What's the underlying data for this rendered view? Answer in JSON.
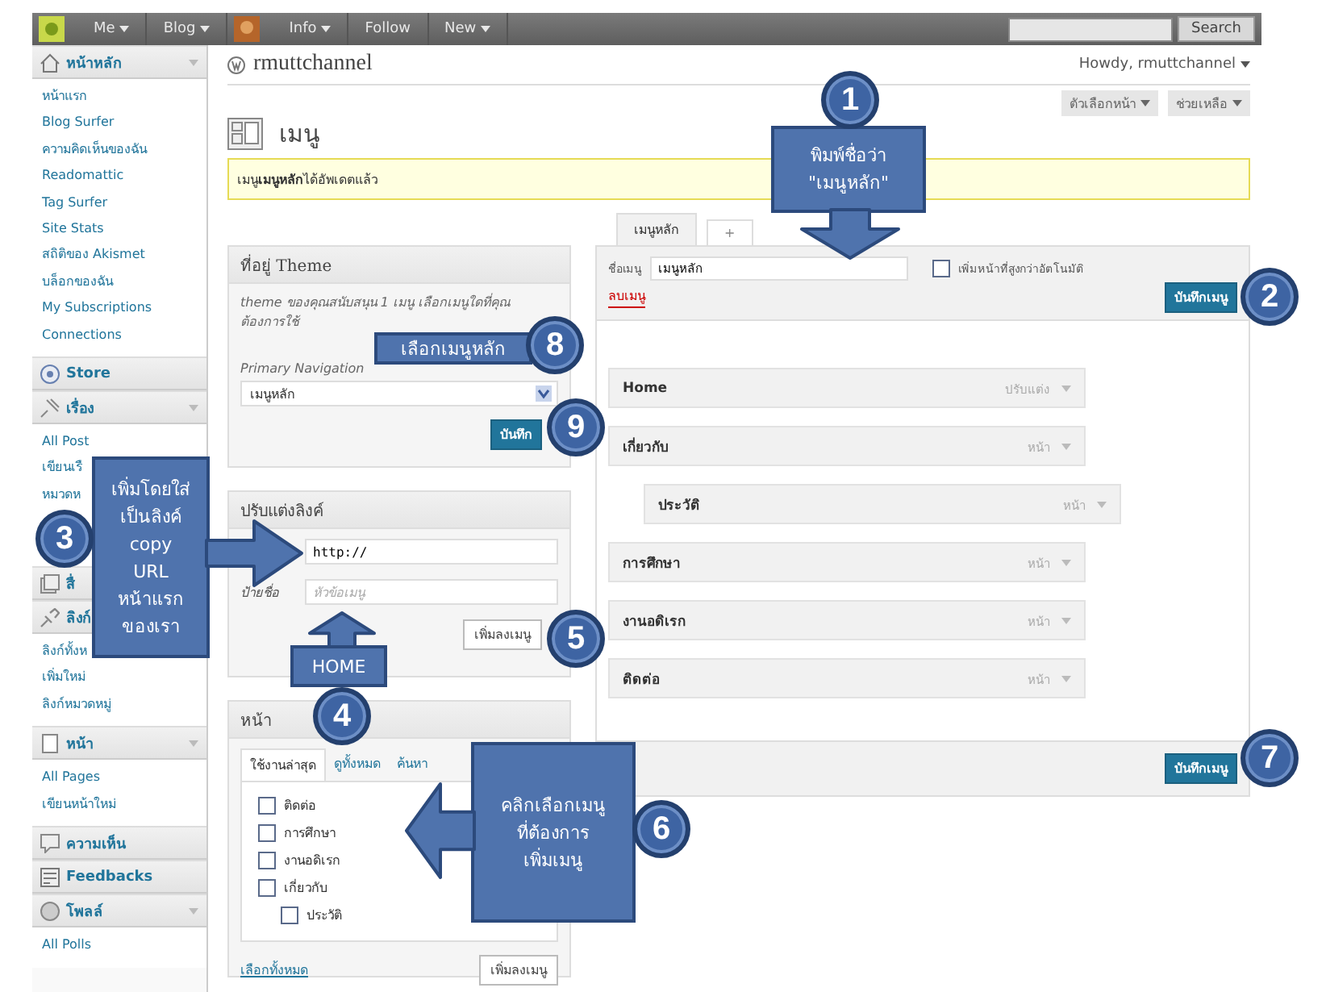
{
  "admin_bar": {
    "items": [
      {
        "label": "Me",
        "dropdown": true
      },
      {
        "label": "Blog",
        "dropdown": true
      },
      {
        "label": "Info",
        "dropdown": true
      },
      {
        "label": "Follow",
        "dropdown": false
      },
      {
        "label": "New",
        "dropdown": true
      }
    ],
    "search_button": "Search"
  },
  "sidebar": {
    "sections": [
      {
        "label": "หน้าหลัก",
        "collapsible": true,
        "items": [
          "หน้าแรก",
          "Blog Surfer",
          "ความคิดเห็นของฉัน",
          "Readomattic",
          "Tag Surfer",
          "Site Stats",
          "สถิติของ Akismet",
          "บล็อกของฉัน",
          "My Subscriptions",
          "Connections"
        ]
      },
      {
        "label": "Store",
        "collapsible": false
      },
      {
        "label": "เรื่อง",
        "collapsible": true,
        "items": [
          "All Post",
          "เขียนเรื",
          "หมวดห"
        ]
      },
      {
        "label": "สื่"
      },
      {
        "label": "ลิงก์",
        "items": [
          "ลิงก์ทั้งห",
          "เพิ่มใหม่",
          "ลิงก์หมวดหมู่"
        ]
      },
      {
        "label": "หน้า",
        "collapsible": true,
        "items": [
          "All Pages",
          "เขียนหน้าใหม่"
        ]
      },
      {
        "label": "ความเห็น",
        "collapsible": false
      },
      {
        "label": "Feedbacks",
        "collapsible": false
      },
      {
        "label": "โพลล์",
        "collapsible": true,
        "items": [
          "All Polls"
        ]
      }
    ]
  },
  "header": {
    "site_title": "rmuttchannel",
    "greeting": "Howdy, rmuttchannel",
    "screen_tabs": [
      "ตัวเลือกหน้า",
      "ช่วยเหลือ"
    ]
  },
  "page_title": "เมนู",
  "notice": "เมนู**เมนูหลัก** ได้อัพเดตแล้ว",
  "theme_locations": {
    "title": "ที่อยู่ Theme",
    "description": "theme ของคุณสนับสนุน 1 เมนู เลือกเมนูใดที่คุณต้องการใช้",
    "location_label": "Primary Navigation",
    "selected_menu": "เมนูหลัก",
    "button": "บันทึก"
  },
  "custom_links": {
    "title": "ปรับแต่งลิงค์",
    "url_value": "http://",
    "label_label": "ป้ายชื่อ",
    "label_placeholder": "หัวข้อเมนู",
    "button": "เพิ่มลงเมนู"
  },
  "pages_box": {
    "title": "หน้า",
    "tabs": [
      {
        "label": "ใช้งานล่าสุด",
        "selected": true
      },
      {
        "label": "ดูทั้งหมด",
        "selected": false
      },
      {
        "label": "ค้นหา",
        "selected": false
      }
    ],
    "pages": [
      {
        "label": "ติดต่อ",
        "checked": false
      },
      {
        "label": "การศึกษา",
        "checked": false
      },
      {
        "label": "งานอดิเรก",
        "checked": false
      },
      {
        "label": "เกี่ยวกับ",
        "checked": false,
        "children": [
          {
            "label": "ประวัติ",
            "checked": false
          }
        ]
      }
    ],
    "select_all": "เลือกทั้งหมด",
    "button": "เพิ่มลงเมนู"
  },
  "menu_tabs": [
    {
      "label": "เมนูหลัก",
      "selected": true
    },
    {
      "label": "+",
      "selected": false
    }
  ],
  "menu_editor": {
    "name_label": "ชื่อเมนู",
    "name_value": "เมนูหลัก",
    "auto_add_label": "เพิ่มหน้าที่สูงกว่าอัตโนมัติ",
    "auto_add_checked": false,
    "delete_link": "ลบเมนู",
    "save_button": "บันทึกเมนู",
    "items": [
      {
        "label": "Home",
        "type": "ปรับแต่ง"
      },
      {
        "label": "เกี่ยวกับ",
        "type": "หน้า",
        "children": [
          {
            "label": "ประวัติ",
            "type": "หน้า"
          }
        ]
      },
      {
        "label": "การศึกษา",
        "type": "หน้า"
      },
      {
        "label": "งานอดิเรก",
        "type": "หน้า"
      },
      {
        "label": "ติดต่อ",
        "type": "หน้า"
      }
    ],
    "footer_button": "บันทึกเมนู"
  },
  "annotations": [
    {
      "number": "1",
      "lines": [
        "พิมพ์ชื่อว่า",
        "\"เมนูหลัก\""
      ]
    },
    {
      "number": "2"
    },
    {
      "number": "3",
      "lines": [
        "เพิ่มโดยใส่",
        "เป็นลิงค์",
        "copy",
        "URL",
        "หน้าแรก",
        "ของเรา"
      ]
    },
    {
      "number": "4",
      "lines": [
        "HOME"
      ]
    },
    {
      "number": "5"
    },
    {
      "number": "6",
      "lines": [
        "คลิกเลือกเมนู",
        "ที่ต้องการ",
        "เพิ่มเมนู"
      ]
    },
    {
      "number": "7"
    },
    {
      "number": "8",
      "lines": [
        "เลือกเมนูหลัก"
      ]
    },
    {
      "number": "9"
    }
  ]
}
